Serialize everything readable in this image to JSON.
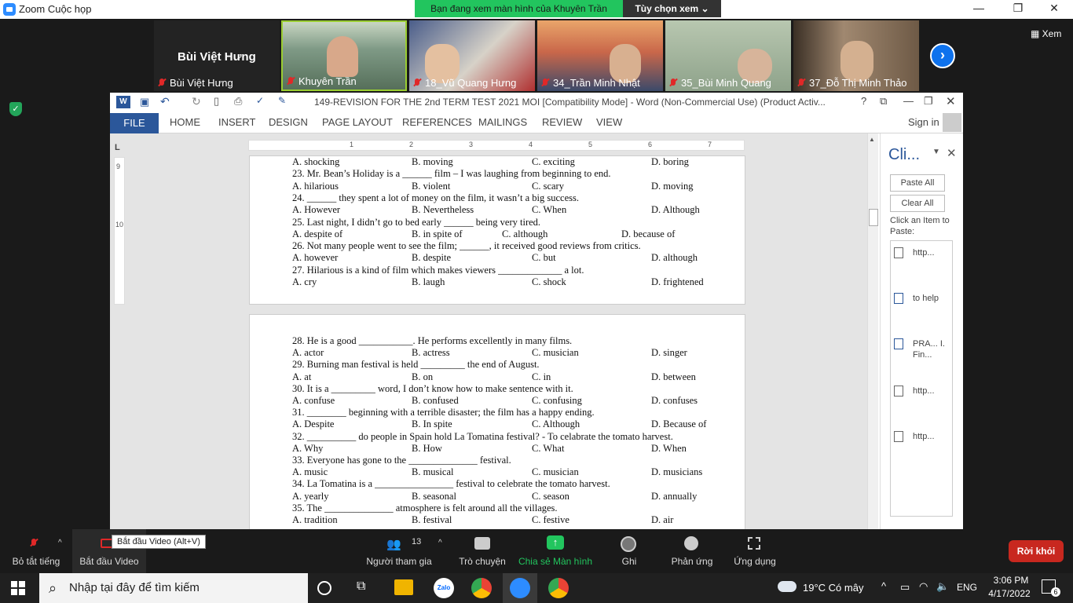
{
  "zoom": {
    "title": "Zoom Cuộc họp",
    "share_notice": "Bạn đang xem màn hình của Khuyên Trần",
    "view_options": "Tùy chọn xem",
    "view_label": "Xem",
    "participants": [
      {
        "name": "Bùi Việt Hưng",
        "big_name": "Bùi Việt Hưng"
      },
      {
        "name": "Khuyên Trần"
      },
      {
        "name": "18_Vũ Quang Hưng"
      },
      {
        "name": "34_Trần Minh Nhật"
      },
      {
        "name": "35_Bùi Minh Quang"
      },
      {
        "name": "37_Đỗ Thị Minh Thảo"
      }
    ],
    "toolbar": {
      "mute": "Bỏ tắt tiếng",
      "video": "Bắt đầu Video",
      "video_tooltip": "Bắt đầu Video (Alt+V)",
      "participants": "Người tham gia",
      "participants_count": "13",
      "chat": "Trò chuyện",
      "share": "Chia sẻ Màn hình",
      "record": "Ghi",
      "reactions": "Phản ứng",
      "apps": "Ứng dụng",
      "leave": "Rời khỏi"
    },
    "colors": {
      "share_green": "#22c55e",
      "leave_red": "#c8281f",
      "zoom_blue": "#0e72ed"
    }
  },
  "word": {
    "title": "149-REVISION FOR THE 2nd TERM TEST 2021 MOI [Compatibility Mode] - Word (Non-Commercial Use) (Product Activ...",
    "tabs": [
      "FILE",
      "HOME",
      "INSERT",
      "DESIGN",
      "PAGE LAYOUT",
      "REFERENCES",
      "MAILINGS",
      "REVIEW",
      "VIEW"
    ],
    "sign_in": "Sign in",
    "ruler_marks": [
      "1",
      "2",
      "3",
      "4",
      "5",
      "6",
      "7"
    ],
    "vruler_marks": [
      "9",
      "10"
    ],
    "page1_lines": [
      {
        "q": "A. shocking",
        "opts": [
          "B. moving",
          "C. exciting",
          "D. boring"
        ]
      },
      {
        "q": "23. Mr. Bean’s Holiday is a ______ film – I was laughing from beginning to end."
      },
      {
        "q": "A. hilarious",
        "opts": [
          "B. violent",
          "C. scary",
          "D. moving"
        ]
      },
      {
        "q": "24. ______ they spent a lot of money on the film, it wasn’t a big success."
      },
      {
        "q": "A. However",
        "opts": [
          "B. Nevertheless",
          "C. When",
          "D. Although"
        ]
      },
      {
        "q": "25. Last night, I didn’t go to bed early ______ being very tired."
      },
      {
        "q": "A. despite of",
        "opts": [
          "B. in spite of",
          "C. although",
          "D. because of"
        ],
        "alt": true
      },
      {
        "q": "26. Not many people went to see the film; ______, it received good reviews from critics."
      },
      {
        "q": "A. however",
        "opts": [
          "B. despite",
          "C. but",
          "D. although"
        ]
      },
      {
        "q": "27. Hilarious is a kind of film which makes viewers _____________ a lot."
      },
      {
        "q": "A. cry",
        "opts": [
          "B. laugh",
          "C. shock",
          "D. frightened"
        ]
      }
    ],
    "page2_lines": [
      {
        "q": "28. He is a good ___________. He performs excellently in many films."
      },
      {
        "q": "A. actor",
        "opts": [
          "B. actress",
          "C. musician",
          "D. singer"
        ]
      },
      {
        "q": "29. Burning man festival is held _________ the end of August."
      },
      {
        "q": "A. at",
        "opts": [
          "B. on",
          "C. in",
          "D. between"
        ]
      },
      {
        "q": "30. It is a _________ word, I don’t know how to make sentence with it."
      },
      {
        "q": "A. confuse",
        "opts": [
          "B. confused",
          "C. confusing",
          "D. confuses"
        ]
      },
      {
        "q": "31. ________ beginning with a terrible disaster; the film has a happy ending."
      },
      {
        "q": "A. Despite",
        "opts": [
          "B. In spite",
          "C. Although",
          "D. Because of"
        ]
      },
      {
        "q": "32. __________ do people in Spain hold La Tomatina festival? - To celabrate the tomato harvest."
      },
      {
        "q": "A. Why",
        "opts": [
          "B. How",
          "C. What",
          "D. When"
        ]
      },
      {
        "q": "33. Everyone has gone to the ______________ festival."
      },
      {
        "q": "A. music",
        "opts": [
          "B. musical",
          "C. musician",
          "D. musicians"
        ]
      },
      {
        "q": "34. La Tomatina is a ________________ festival to celebrate the tomato harvest."
      },
      {
        "q": "A. yearly",
        "opts": [
          "B. seasonal",
          "C. season",
          "D. annually"
        ]
      },
      {
        "q": "35. The ______________ atmosphere is felt around all the villages."
      },
      {
        "q": "A. tradition",
        "opts": [
          "B. festival",
          "C. festive",
          "D. air"
        ]
      }
    ],
    "clipboard": {
      "title": "Cli...",
      "paste_all": "Paste All",
      "clear_all": "Clear All",
      "hint": "Click an Item to Paste:",
      "items": [
        "http...",
        "to help",
        "PRA... I. Fin...",
        "http...",
        "http..."
      ]
    }
  },
  "taskbar": {
    "search_placeholder": "Nhập tại đây để tìm kiếm",
    "weather": "19°C  Có mây",
    "lang": "ENG",
    "time": "3:06 PM",
    "date": "4/17/2022",
    "notifications": "6",
    "zalo_label": "Zalo"
  }
}
